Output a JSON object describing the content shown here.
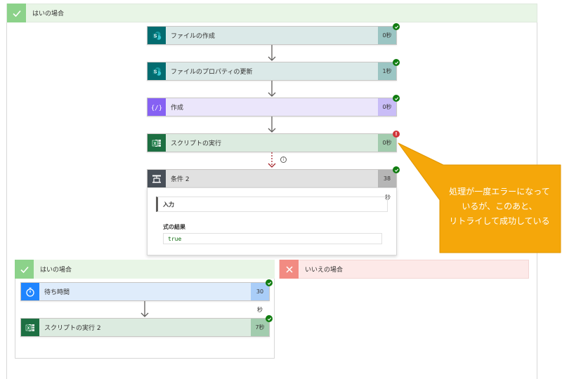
{
  "top_branch": {
    "label": "はいの場合"
  },
  "steps": [
    {
      "title": "ファイルの作成",
      "duration": "0秒",
      "status": "success",
      "icon": "sharepoint-icon"
    },
    {
      "title": "ファイルのプロパティの更新",
      "duration": "1秒",
      "status": "success",
      "icon": "sharepoint-icon"
    },
    {
      "title": "作成",
      "duration": "0秒",
      "status": "success",
      "icon": "compose-icon"
    },
    {
      "title": "スクリプトの実行",
      "duration": "0秒",
      "status": "error",
      "icon": "excel-icon"
    }
  ],
  "condition": {
    "title": "条件 2",
    "duration": "38",
    "duration_suffix": "秒",
    "inputs_label": "入力",
    "result_label": "式の結果",
    "result_value": "true",
    "info_glyph": "i"
  },
  "yes_branch": {
    "label": "はいの場合",
    "steps": [
      {
        "title": "待ち時間",
        "duration": "30",
        "duration_suffix": "秒",
        "icon": "timer-icon"
      },
      {
        "title": "スクリプトの実行 2",
        "duration": "7秒",
        "icon": "excel-icon"
      }
    ]
  },
  "no_branch": {
    "label": "いいえの場合"
  },
  "callout": {
    "lines": [
      "処理が一度エラーになって",
      "いるが、このあと、",
      "リトライして成功している"
    ],
    "color": "#f4a70b"
  },
  "colors": {
    "success": "#107c10",
    "error": "#d13438"
  }
}
